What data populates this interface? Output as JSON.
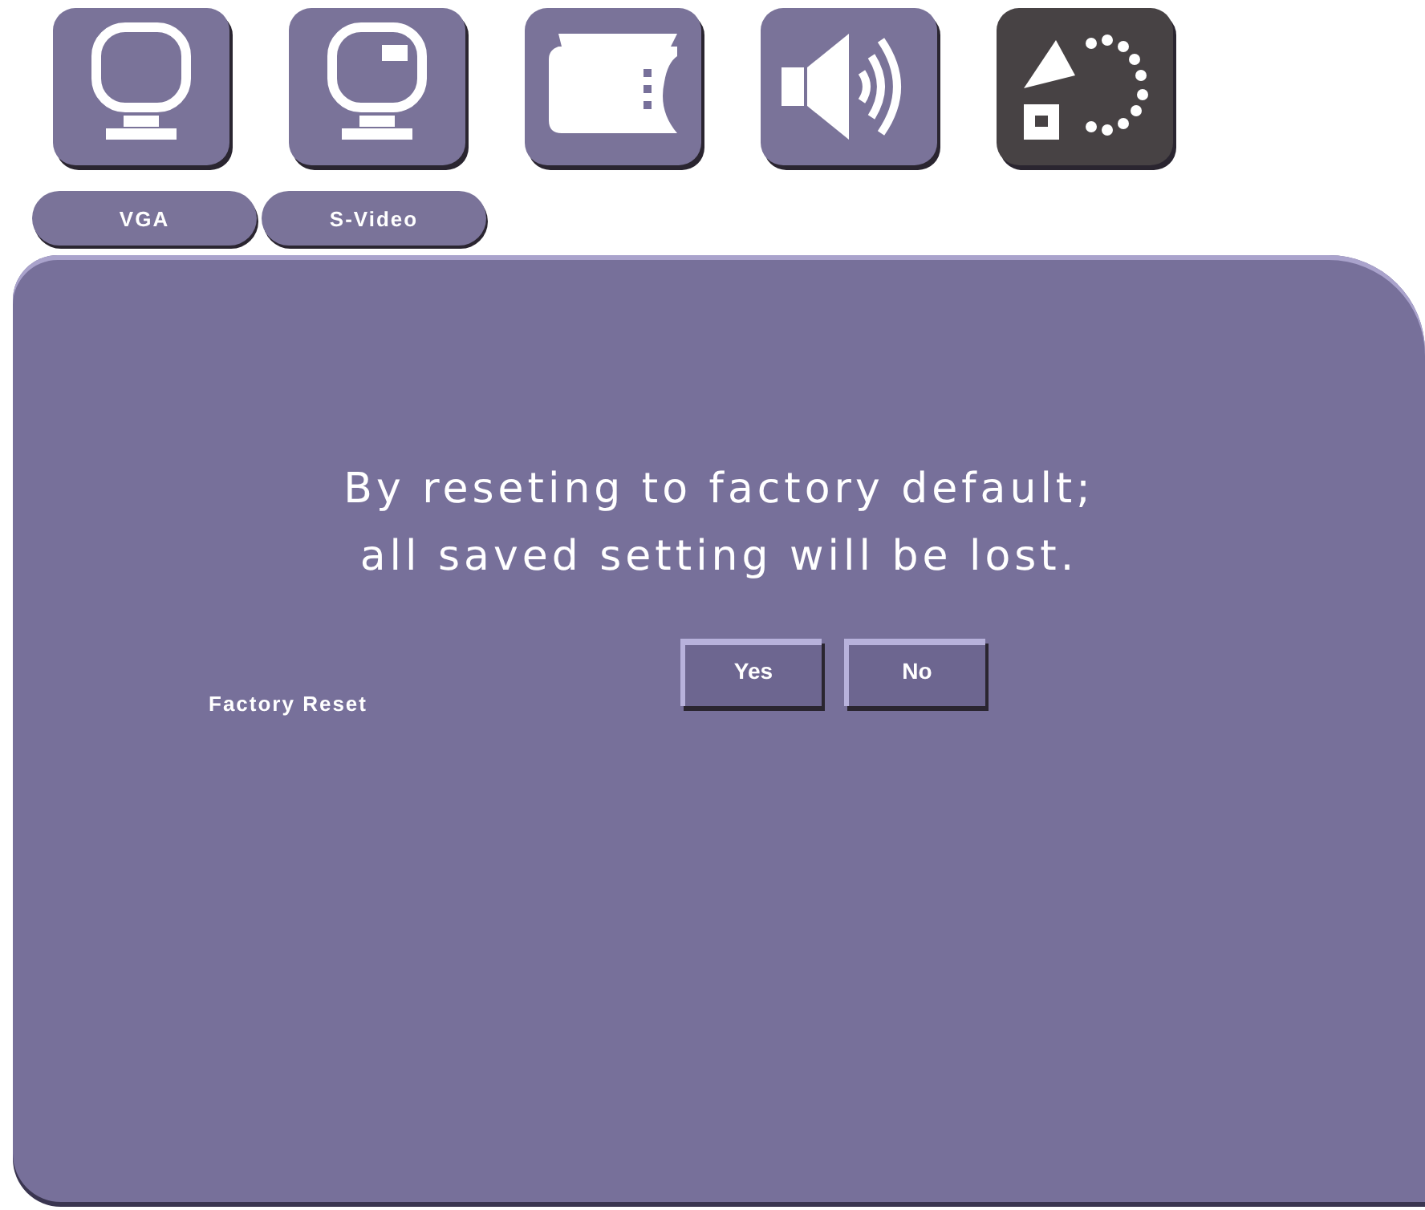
{
  "tabs": [
    {
      "kind": "monitor",
      "selected": false
    },
    {
      "kind": "monitor-inset",
      "selected": false
    },
    {
      "kind": "film",
      "selected": false
    },
    {
      "kind": "speaker",
      "selected": false
    },
    {
      "kind": "shapes",
      "selected": true
    }
  ],
  "sources": [
    "VGA",
    "S-Video"
  ],
  "dialog": {
    "message_lines": [
      "By reseting to factory default;",
      "all saved setting will be lost."
    ],
    "setting_label": "Factory Reset",
    "buttons": [
      "Yes",
      "No"
    ]
  }
}
